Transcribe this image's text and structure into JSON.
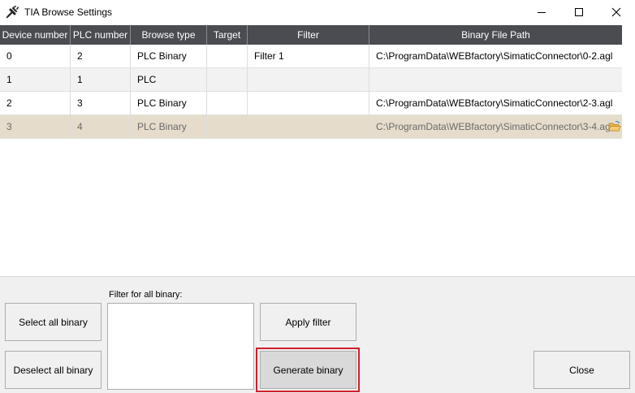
{
  "window": {
    "title": "TIA Browse Settings",
    "icon": "plug-settings-icon"
  },
  "grid": {
    "headers": [
      "Device number",
      "PLC number",
      "Browse type",
      "Target",
      "Filter",
      "Binary File Path"
    ],
    "rows": [
      {
        "device": "0",
        "plc": "2",
        "browse_type": "PLC Binary",
        "target": "",
        "filter": "Filter 1",
        "path": "C:\\ProgramData\\WEBfactory\\SimaticConnector\\0-2.agl"
      },
      {
        "device": "1",
        "plc": "1",
        "browse_type": "PLC",
        "target": "",
        "filter": "",
        "path": ""
      },
      {
        "device": "2",
        "plc": "3",
        "browse_type": "PLC Binary",
        "target": "",
        "filter": "",
        "path": "C:\\ProgramData\\WEBfactory\\SimaticConnector\\2-3.agl"
      },
      {
        "device": "3",
        "plc": "4",
        "browse_type": "PLC Binary",
        "target": "",
        "filter": "",
        "path": "C:\\ProgramData\\WEBfactory\\SimaticConnector\\3-4.agl"
      }
    ],
    "selected_row_index": 3
  },
  "bottom": {
    "select_all_label": "Select all binary",
    "deselect_all_label": "Deselect all binary",
    "filter_label": "Filter for all binary:",
    "filter_value": "",
    "apply_filter_label": "Apply filter",
    "generate_binary_label": "Generate binary",
    "close_label": "Close"
  },
  "colors": {
    "header_bg": "#4a4c52",
    "selected_row_bg": "#e5dccb",
    "highlight_border": "#d0202a"
  }
}
